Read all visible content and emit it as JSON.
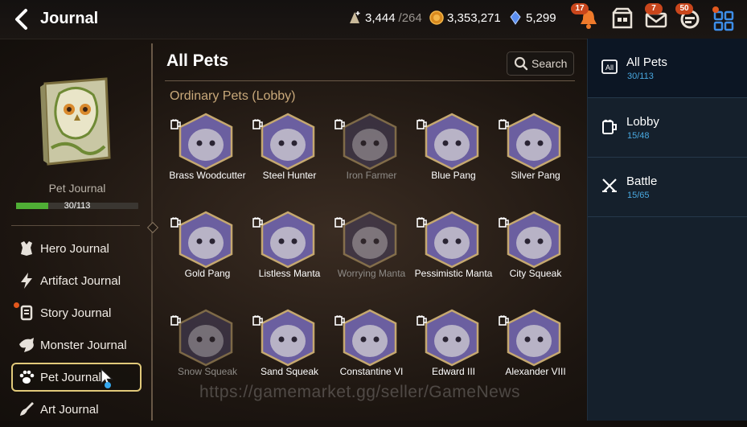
{
  "header": {
    "title": "Journal",
    "resources": [
      {
        "icon": "stamina-icon",
        "value": "3,444",
        "max": "/264"
      },
      {
        "icon": "gold-coin-icon",
        "value": "3,353,271",
        "max": ""
      },
      {
        "icon": "skystone-icon",
        "value": "5,299",
        "max": ""
      }
    ],
    "badges": {
      "notifications": "17",
      "mail": "7",
      "chat": "50"
    }
  },
  "left_panel": {
    "journal_label": "Pet Journal",
    "progress_text": "30/113",
    "progress_fraction": 0.265,
    "menu": [
      {
        "label": "Hero Journal",
        "icon": "hero-icon",
        "active": false,
        "dot": false
      },
      {
        "label": "Artifact Journal",
        "icon": "artifact-icon",
        "active": false,
        "dot": false
      },
      {
        "label": "Story Journal",
        "icon": "story-scroll-icon",
        "active": false,
        "dot": true
      },
      {
        "label": "Monster Journal",
        "icon": "monster-icon",
        "active": false,
        "dot": false
      },
      {
        "label": "Pet Journal",
        "icon": "paw-icon",
        "active": true,
        "dot": false
      },
      {
        "label": "Art Journal",
        "icon": "art-brush-icon",
        "active": false,
        "dot": false
      }
    ]
  },
  "main": {
    "title": "All Pets",
    "search_label": "Search",
    "section_title": "Ordinary Pets (Lobby)",
    "pets": [
      {
        "name": "Brass Woodcutter",
        "color": "#6b5fa0",
        "locked": false
      },
      {
        "name": "Steel Hunter",
        "color": "#6b5fa0",
        "locked": false
      },
      {
        "name": "Iron Farmer",
        "color": "#4a4260",
        "locked": true
      },
      {
        "name": "Blue Pang",
        "color": "#6b5fa0",
        "locked": false
      },
      {
        "name": "Silver Pang",
        "color": "#6b5fa0",
        "locked": false
      },
      {
        "name": "Gold Pang",
        "color": "#6b5fa0",
        "locked": false
      },
      {
        "name": "Listless Manta",
        "color": "#6b5fa0",
        "locked": false
      },
      {
        "name": "Worrying Manta",
        "color": "#4a4260",
        "locked": true
      },
      {
        "name": "Pessimistic Manta",
        "color": "#6b5fa0",
        "locked": false
      },
      {
        "name": "City Squeak",
        "color": "#6b5fa0",
        "locked": false
      },
      {
        "name": "Snow Squeak",
        "color": "#4a4260",
        "locked": true
      },
      {
        "name": "Sand Squeak",
        "color": "#6b5fa0",
        "locked": false
      },
      {
        "name": "Constantine VI",
        "color": "#6b5fa0",
        "locked": false
      },
      {
        "name": "Edward III",
        "color": "#6b5fa0",
        "locked": false
      },
      {
        "name": "Alexander VIII",
        "color": "#6b5fa0",
        "locked": false
      }
    ]
  },
  "right_panel": {
    "tabs": [
      {
        "label": "All Pets",
        "count": "30/113",
        "icon": "all-icon",
        "active": true
      },
      {
        "label": "Lobby",
        "count": "15/48",
        "icon": "beer-mug-icon",
        "active": false
      },
      {
        "label": "Battle",
        "count": "15/65",
        "icon": "crossed-swords-icon",
        "active": false
      }
    ]
  },
  "watermark": "https://gamemarket.gg/seller/GameNews",
  "colors": {
    "progress": "#4fae35",
    "accent_blue": "#49a8e0",
    "active_border": "#e1c97a",
    "badge": "#c9461c"
  }
}
